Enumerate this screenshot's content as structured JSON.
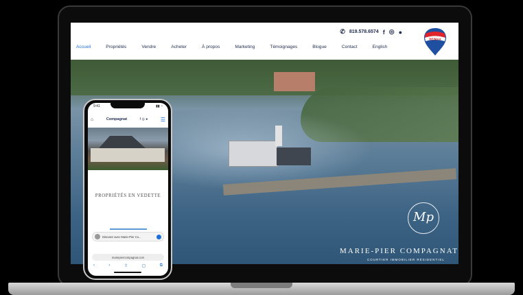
{
  "site": {
    "phone_number": "819.578.6574",
    "nav": [
      {
        "label": "Accueil",
        "active": true
      },
      {
        "label": "Propriétés",
        "active": false
      },
      {
        "label": "Vendre",
        "active": false
      },
      {
        "label": "Acheter",
        "active": false
      },
      {
        "label": "À propos",
        "active": false
      },
      {
        "label": "Marketing",
        "active": false
      },
      {
        "label": "Témoignages",
        "active": false
      },
      {
        "label": "Blogue",
        "active": false
      },
      {
        "label": "Contact",
        "active": false
      },
      {
        "label": "English",
        "active": false
      }
    ],
    "logo_text": "RE/MAX",
    "social_icons": [
      "facebook-icon",
      "instagram-icon",
      "pinterest-icon"
    ],
    "brand_name": "MARIE-PIER COMPAGNAT",
    "brand_monogram": "Mp",
    "brand_sub": "COURTIER IMMOBILIER RÉSIDENTIEL"
  },
  "phone": {
    "status_time": "9:41",
    "header_text": "Compagnat",
    "section_title": "PROPRIÉTÉS EN VEDETTE",
    "messenger_text": "Discutez avec Marie-Pier Co...",
    "url_text": "mariepiercompagnat.com",
    "toolbar": [
      "‹",
      "›",
      "⇧",
      "▢",
      "⧉"
    ]
  },
  "colors": {
    "navy": "#1f2b50",
    "accent_blue": "#1b6fd6",
    "remax_red": "#e1232b"
  }
}
